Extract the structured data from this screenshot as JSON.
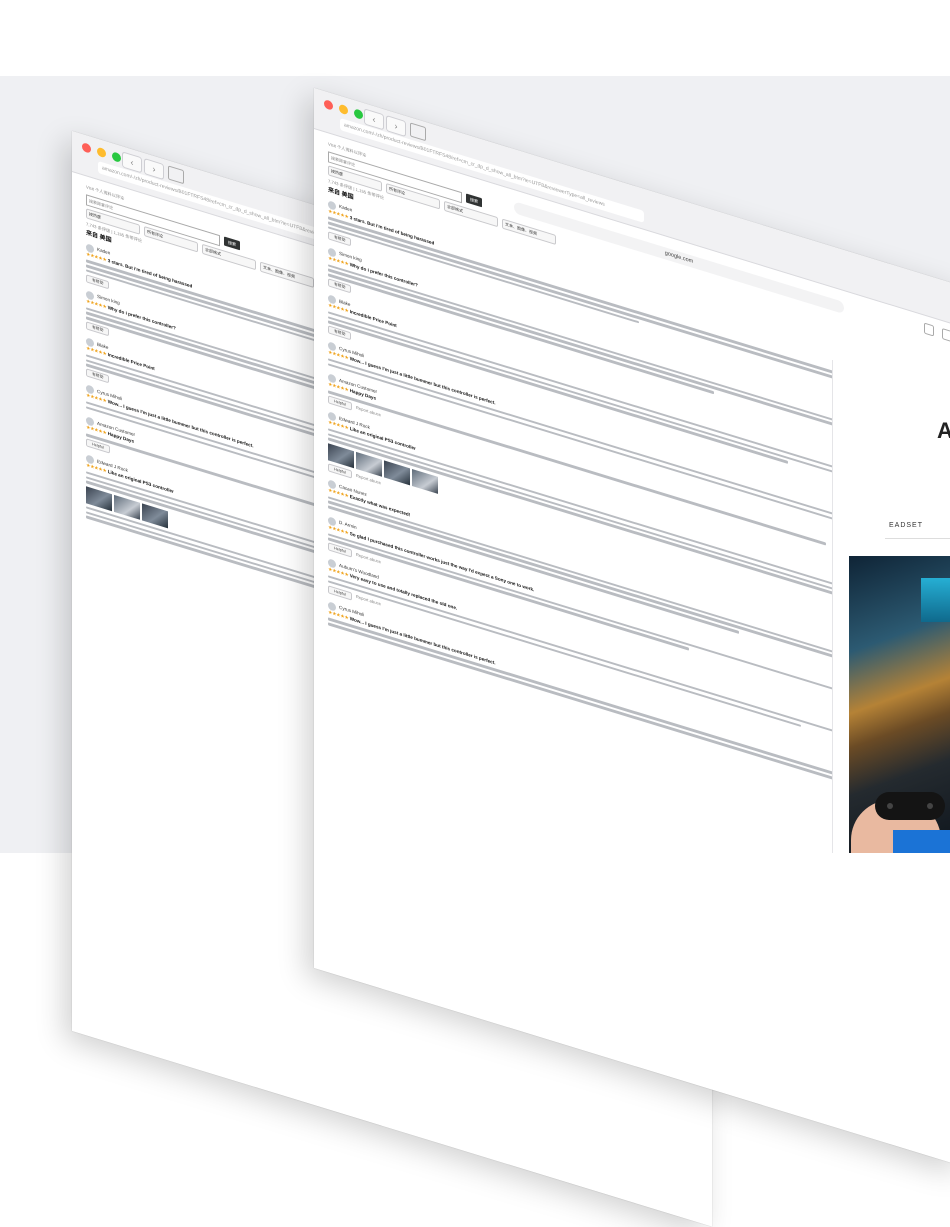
{
  "back_window": {
    "tab_url": "amazon.com/-/zh/product-reviews/B01FTRFS48/ref=cm_cr_dp_d_show_all_btm?ie=UTF8&reviewerType=all_reviews",
    "subtitle": "Visit 个人资料以评论",
    "search_placeholder": "搜索顾客评论",
    "search_button": "搜索",
    "filters": [
      "按热度",
      "所有评论",
      "全部格式",
      "文本、图像、视频"
    ],
    "rating_count": "7,743 条评级 | 1,155 条带评论",
    "section_heading": "来自 美国",
    "reviews": [
      {
        "name": "Kaden",
        "title": "3 stars. But i'm tired of being harassed",
        "helpful": "有帮助"
      },
      {
        "name": "Simon king",
        "title": "Why do i prefer this controller?",
        "helpful": "有帮助"
      },
      {
        "name": "Blake",
        "title": "Incredible Price Point",
        "helpful": "有帮助"
      },
      {
        "name": "Cyrus Miholi",
        "title": "Wow... I guess I'm just a little bummer but this controller is perfect.",
        "helpful": "有帮助"
      },
      {
        "name": "Amazon Customer",
        "title": "Happy Days",
        "helpful": "Helpful"
      },
      {
        "name": "Edward J Rock",
        "title": "Like an original PS3 controller",
        "helpful": "Helpful"
      }
    ]
  },
  "front_window": {
    "tab_url": "amazon.com/-/zh/product-reviews/B01FTRFS48/ref=cm_cr_dp_d_show_all_btm?ie=UTF8&reviewerType=all_reviews",
    "address_bar": "google.com",
    "subtitle": "Visit 个人资料以评论",
    "search_placeholder": "搜索顾客评论",
    "search_button": "搜索",
    "filters": [
      "按热度",
      "所有评论",
      "全部格式",
      "文本、图像、视频"
    ],
    "rating_count": "7,743 条评级 | 1,155 条带评论",
    "section_heading": "来自 美国",
    "reviews": [
      {
        "name": "Kaden",
        "title": "3 stars. But i'm tired of being harassed",
        "helpful": "有帮助"
      },
      {
        "name": "Simon king",
        "title": "Why do i prefer this controller?",
        "helpful": "有帮助"
      },
      {
        "name": "Blake",
        "title": "Incredible Price Point",
        "helpful": "有帮助"
      },
      {
        "name": "Cyrus Miholi",
        "title": "Wow... I guess I'm just a little bummer but this controller is perfect.",
        "helpful": "有帮助"
      },
      {
        "name": "Amazon Customer",
        "title": "Happy Days",
        "helpful": "Helpful"
      },
      {
        "name": "Edward J Rock",
        "title": "Like an original PS3 controller",
        "helpful": "Helpful"
      },
      {
        "name": "Cacao Nunez",
        "title": "Exactly what was expected!",
        "helpful": "Helpful"
      },
      {
        "name": "D. Armin",
        "title": "So glad I purchased this controller works just the way I'd expect a Sony one to work.",
        "helpful": "Helpful"
      },
      {
        "name": "Auburn's Woodland",
        "title": "Very easy to use and totally replaced the old one.",
        "helpful": "Helpful"
      },
      {
        "name": "Cyrus Miholi",
        "title": "Wow... I guess I'm just a little bummer but this controller is perfect.",
        "helpful": "Helpful"
      }
    ],
    "report": "Report abuse"
  },
  "promo": {
    "big_text": "AL",
    "subtitle": "EADSET"
  },
  "colors": {
    "accent_star": "#f0a41e",
    "verified": "#c45500",
    "background_band": "#eff0f3"
  }
}
